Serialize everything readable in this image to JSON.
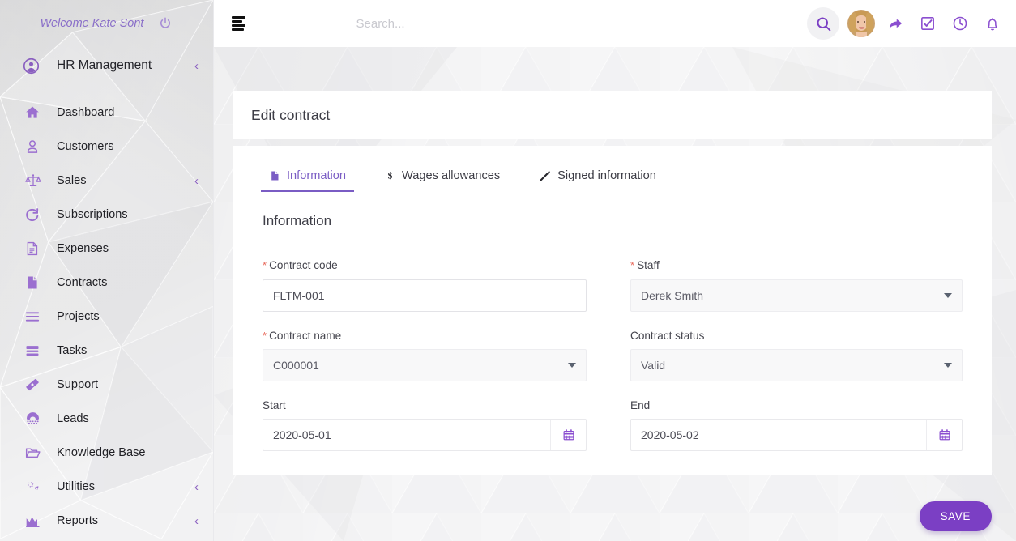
{
  "sidebar": {
    "welcome": "Welcome Kate Sont",
    "power_icon": "power-icon",
    "section": {
      "label": "HR Management",
      "icon": "user-circle-icon",
      "chevron": "‹"
    },
    "items": [
      {
        "label": "Dashboard",
        "icon": "home-icon",
        "chevron": ""
      },
      {
        "label": "Customers",
        "icon": "user-icon",
        "chevron": ""
      },
      {
        "label": "Sales",
        "icon": "scales-icon",
        "chevron": "‹"
      },
      {
        "label": "Subscriptions",
        "icon": "refresh-icon",
        "chevron": ""
      },
      {
        "label": "Expenses",
        "icon": "file-text-icon",
        "chevron": ""
      },
      {
        "label": "Contracts",
        "icon": "file-solid-icon",
        "chevron": ""
      },
      {
        "label": "Projects",
        "icon": "list-icon",
        "chevron": ""
      },
      {
        "label": "Tasks",
        "icon": "server-icon",
        "chevron": ""
      },
      {
        "label": "Support",
        "icon": "ticket-icon",
        "chevron": ""
      },
      {
        "label": "Leads",
        "icon": "phone-icon",
        "chevron": ""
      },
      {
        "label": "Knowledge Base",
        "icon": "folder-open-icon",
        "chevron": ""
      },
      {
        "label": "Utilities",
        "icon": "gears-icon",
        "chevron": "‹"
      },
      {
        "label": "Reports",
        "icon": "chart-area-icon",
        "chevron": "‹"
      }
    ]
  },
  "topbar": {
    "menu_icon": "hamburger-icon",
    "search_placeholder": "Search...",
    "search_value": "",
    "icons": [
      "search-icon",
      "avatar",
      "share-icon",
      "check-square-icon",
      "clock-icon",
      "bell-icon"
    ]
  },
  "page": {
    "title": "Edit contract",
    "tabs": [
      {
        "label": "Information",
        "icon": "file-icon",
        "active": true
      },
      {
        "label": "Wages allowances",
        "icon": "dollar-icon",
        "active": false
      },
      {
        "label": "Signed information",
        "icon": "pencil-icon",
        "active": false
      }
    ],
    "section_title": "Information",
    "fields": [
      {
        "label": "Contract code",
        "required": true,
        "type": "text",
        "value": "FLTM-001"
      },
      {
        "label": "Staff",
        "required": true,
        "type": "select",
        "value": "Derek Smith"
      },
      {
        "label": "Contract name",
        "required": true,
        "type": "select",
        "value": "C000001"
      },
      {
        "label": "Contract status",
        "required": false,
        "type": "select",
        "value": "Valid"
      },
      {
        "label": "Start",
        "required": false,
        "type": "date",
        "value": "2020-05-01"
      },
      {
        "label": "End",
        "required": false,
        "type": "date",
        "value": "2020-05-02"
      }
    ],
    "save_label": "SAVE"
  },
  "colors": {
    "accent": "#7b3fc4",
    "sidebar_icon": "#9b6fd0",
    "required": "#e8685a",
    "tab_active": "#7a5cc4"
  }
}
